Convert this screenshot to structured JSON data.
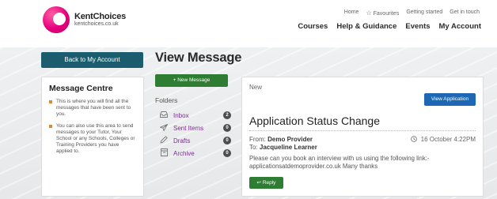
{
  "header": {
    "brand_name": "KentChoices",
    "brand_domain": "kentchoices.co.uk",
    "util_nav": [
      "Home",
      "Favourites",
      "Getting started",
      "Get in touch"
    ],
    "main_nav": [
      "Courses",
      "Help & Guidance",
      "Events",
      "My Account"
    ]
  },
  "left": {
    "back_label": "Back to My Account",
    "panel_title": "Message Centre",
    "panel_items": [
      "This is where you will find all the messages that have been sent to you.",
      "You can also use this area to send messages to your Tutor, Your School or any Schools, Colleges or Training Providers you have applied to."
    ]
  },
  "page_title": "View Message",
  "middle": {
    "new_message_label": "New Message",
    "folders_label": "Folders",
    "folders": [
      {
        "name": "Inbox",
        "count": "2",
        "icon": "inbox-icon"
      },
      {
        "name": "Sent Items",
        "count": "0",
        "icon": "send-icon"
      },
      {
        "name": "Drafts",
        "count": "0",
        "icon": "pencil-icon"
      },
      {
        "name": "Archive",
        "count": "0",
        "icon": "archive-icon"
      }
    ]
  },
  "message": {
    "folder": "New",
    "view_application_label": "View Application",
    "subject": "Application Status Change",
    "from_label": "From:",
    "from": "Demo Provider",
    "to_label": "To:",
    "to": "Jacqueline Learner",
    "date": "16 October 4:22PM",
    "body": "Please can you book an interview with us using the following link:- applicationsatdemoprovider.co.uk Many thanks",
    "reply_label": "Reply"
  },
  "colors": {
    "brand_pink": "#e6007e",
    "back_button": "#1b5d6e",
    "green_button": "#2e7d32",
    "blue_button": "#1e67b3",
    "folder_link": "#7a2e8e",
    "bullet": "#e08a2c"
  }
}
